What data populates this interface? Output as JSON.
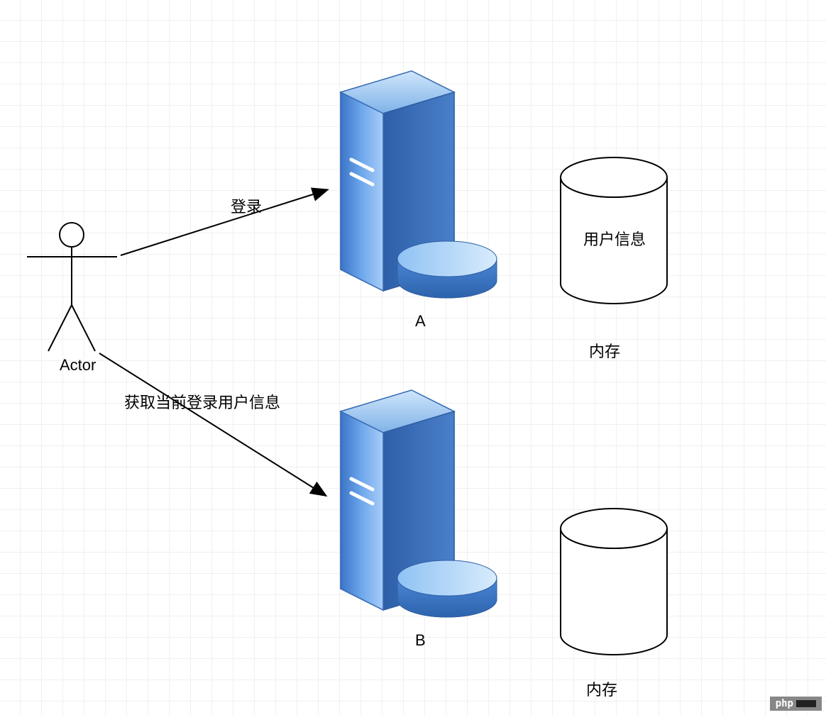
{
  "actor": {
    "label": "Actor"
  },
  "arrows": {
    "login_label": "登录",
    "fetch_user_label": "获取当前登录用户信息"
  },
  "server_a": {
    "label": "A"
  },
  "server_b": {
    "label": "B"
  },
  "storage_a": {
    "content_label": "用户信息",
    "caption": "内存"
  },
  "storage_b": {
    "content_label": "",
    "caption": "内存"
  },
  "watermark": {
    "text": "php"
  }
}
